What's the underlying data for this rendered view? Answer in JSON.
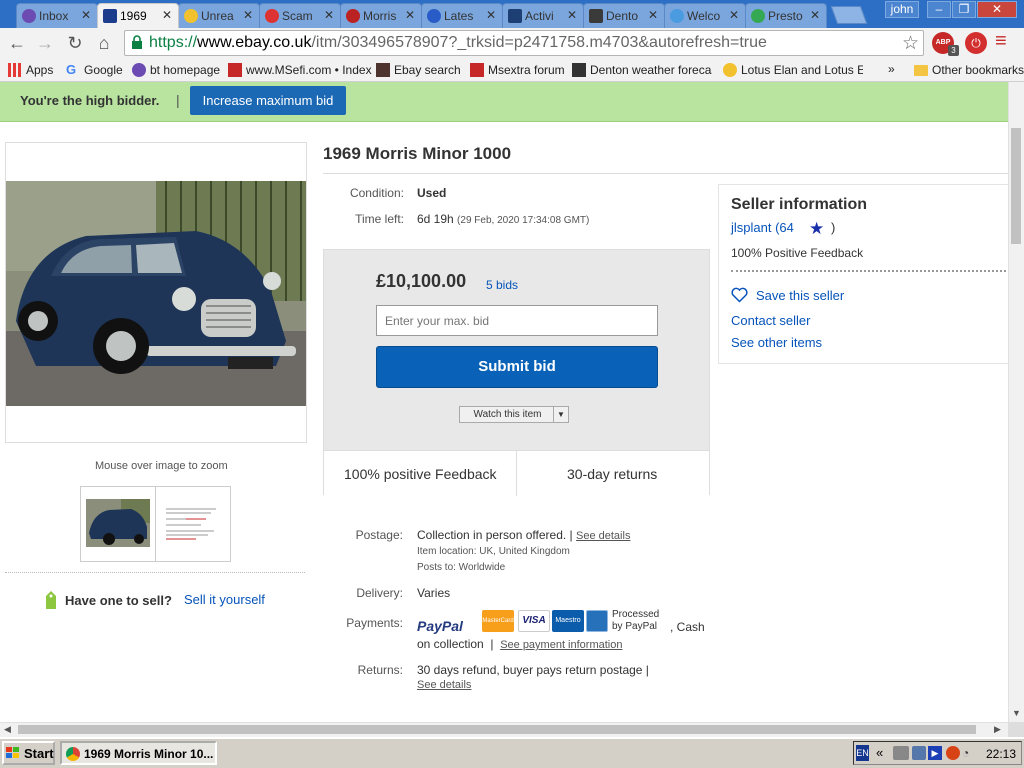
{
  "browser": {
    "tabs": [
      {
        "label": "Inbox",
        "icon": "bt-icon"
      },
      {
        "label": "1969",
        "icon": "ebay-icon",
        "active": true
      },
      {
        "label": "Unrea",
        "icon": "lotus-icon"
      },
      {
        "label": "Scam",
        "icon": "car-icon"
      },
      {
        "label": "Morris",
        "icon": "morris-icon"
      },
      {
        "label": "Lates",
        "icon": "news-icon"
      },
      {
        "label": "Activi",
        "icon": "activity-icon"
      },
      {
        "label": "Dento",
        "icon": "weather-icon"
      },
      {
        "label": "Welco",
        "icon": "bird-icon"
      },
      {
        "label": "Presto",
        "icon": "maps-pin-icon"
      }
    ],
    "user": "john",
    "url_prefix": "https://",
    "url_domain": "www.ebay.co.uk",
    "url_rest": "/itm/303496578907?_trksid=p2471758.m4703&autorefresh=true",
    "abp_label": "ABP",
    "abp_count": "3",
    "bookmarks": [
      {
        "label": "Apps",
        "icon": "apps-grid-icon"
      },
      {
        "label": "Google",
        "icon": "google-icon"
      },
      {
        "label": "bt homepage",
        "icon": "bt-globe-icon"
      },
      {
        "label": "www.MSefi.com • Index",
        "icon": "msefi-icon"
      },
      {
        "label": "Ebay search",
        "icon": "ebay-search-icon"
      },
      {
        "label": "Msextra forum",
        "icon": "msextra-icon"
      },
      {
        "label": "Denton weather forecas",
        "icon": "weather-icon"
      },
      {
        "label": "Lotus Elan and Lotus Ela",
        "icon": "lotus-icon"
      }
    ],
    "more_bookmarks": "»",
    "other_bookmarks": "Other bookmarks"
  },
  "notice": {
    "message": "You're the high bidder.",
    "separator": "|",
    "increase_button": "Increase maximum bid"
  },
  "listing": {
    "title": "1969 Morris Minor 1000",
    "condition_label": "Condition:",
    "condition_value": "Used",
    "time_left_label": "Time left:",
    "time_left_value": "6d 19h",
    "time_left_date": "(29 Feb, 2020   17:34:08 GMT)",
    "zoom_hint": "Mouse over image to zoom",
    "have_one": "Have one to sell?",
    "sell_it": "Sell it yourself"
  },
  "bid": {
    "price": "£10,100.00",
    "bids": "5 bids",
    "input_placeholder": "Enter your max. bid",
    "submit": "Submit bid",
    "watch": "Watch this item",
    "feedback_badge": "100% positive Feedback",
    "returns_badge": "30-day returns"
  },
  "seller": {
    "heading": "Seller information",
    "name": "jlsplant",
    "score": "(64",
    "score_close": ")",
    "feedback": "100% Positive Feedback",
    "save": "Save this seller",
    "contact": "Contact seller",
    "other_items": "See other items"
  },
  "shipping": {
    "postage_label": "Postage:",
    "postage_value": "Collection in person offered.",
    "postage_sep": "|",
    "postage_details": "See details",
    "item_location": "Item location:  UK, United Kingdom",
    "posts_to": "Posts to:  Worldwide",
    "delivery_label": "Delivery:",
    "delivery_value": "Varies",
    "payments_label": "Payments:",
    "paypal": "PayPal",
    "processed": "Processed",
    "processed_by": "by PayPal",
    "cash": ", Cash",
    "cash_line2": "on collection",
    "pay_sep": "|",
    "payment_info": "See payment information",
    "returns_label": "Returns:",
    "returns_value": "30 days refund, buyer pays return postage |",
    "returns_details": "See details",
    "card_labels": [
      "MasterCard",
      "VISA",
      "Maestro",
      ""
    ]
  },
  "taskbar": {
    "start": "Start",
    "task": "1969 Morris Minor 10...",
    "lang": "EN",
    "tray_chevron": "«",
    "clock": "22:13"
  },
  "colors": {
    "accent_blue": "#0654ba",
    "high_bidder_green": "#b8e4a0",
    "submit_blue": "#0961b8",
    "tab_strip": "#2c6fc5"
  }
}
